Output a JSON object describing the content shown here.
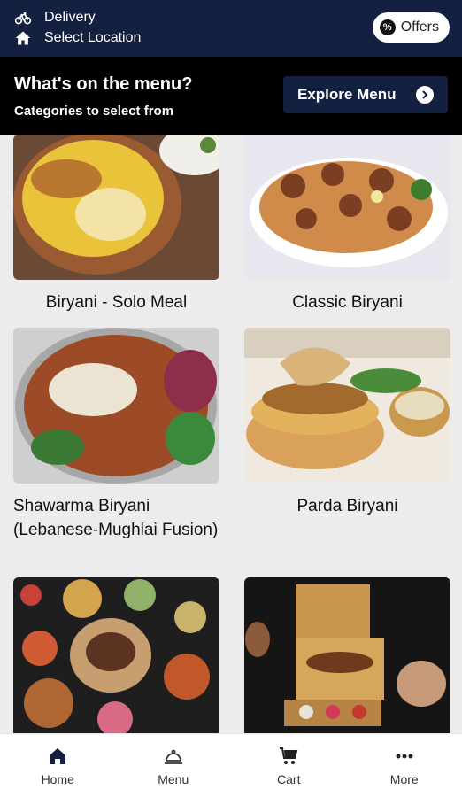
{
  "topbar": {
    "delivery_label": "Delivery",
    "location_label": "Select Location",
    "offers_label": "Offers",
    "offers_icon": "discount-badge-icon"
  },
  "menu_header": {
    "title": "What's on the menu?",
    "subtitle": "Categories to select from",
    "explore_label": "Explore Menu"
  },
  "categories": [
    {
      "name": "Biryani - Solo Meal"
    },
    {
      "name": "Classic Biryani"
    },
    {
      "name": "Shawarma Biryani (Lebanese-Mughlai Fusion)"
    },
    {
      "name": "Parda Biryani"
    },
    {
      "name": ""
    },
    {
      "name": ""
    }
  ],
  "bottom_nav": [
    {
      "label": "Home",
      "icon": "home-icon",
      "active": true
    },
    {
      "label": "Menu",
      "icon": "cloche-icon"
    },
    {
      "label": "Cart",
      "icon": "cart-icon"
    },
    {
      "label": "More",
      "icon": "more-dots-icon"
    }
  ],
  "colors": {
    "brand_navy": "#13203f",
    "header_black": "#000000",
    "background": "#ececec"
  }
}
